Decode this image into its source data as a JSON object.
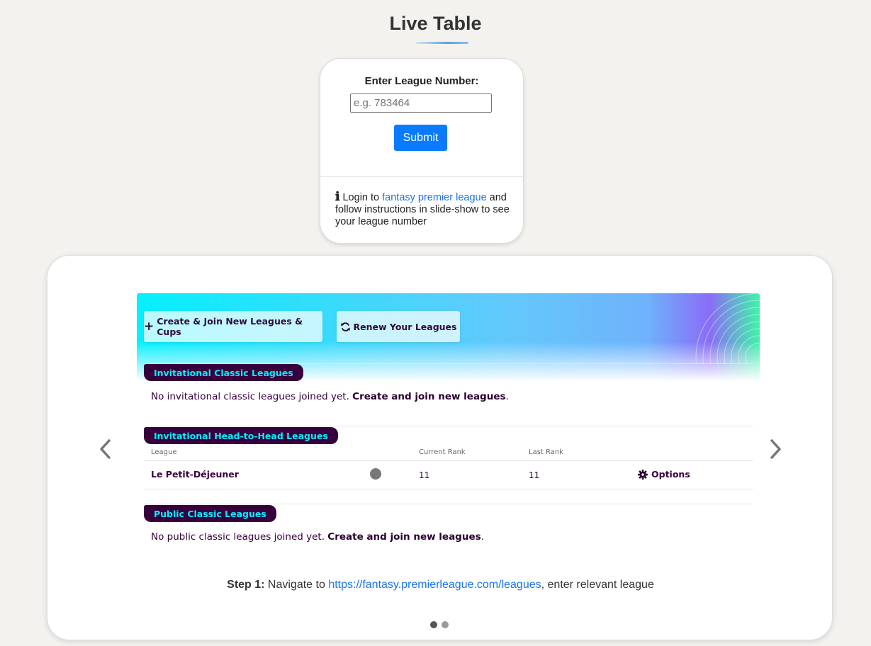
{
  "page": {
    "title": "Live Table"
  },
  "form": {
    "label": "Enter League Number:",
    "input_value": "",
    "input_placeholder": "e.g. 783464",
    "submit_label": "Submit",
    "info_icon": "ℹ",
    "info_prefix": " Login to ",
    "info_link": "fantasy premier league",
    "info_suffix": " and follow instructions in slide-show to see your league number"
  },
  "slideshow": {
    "prev_icon": "chevron-left-icon",
    "next_icon": "chevron-right-icon",
    "image": {
      "buttons": {
        "create": "Create & Join New Leagues & Cups",
        "renew": "Renew Your Leagues"
      },
      "sections": {
        "invitational_classic": {
          "title": "Invitational Classic Leagues",
          "text": "No invitational classic leagues joined yet. ",
          "cta": "Create and join new leagues",
          "end": "."
        },
        "invitational_h2h": {
          "title": "Invitational Head-to-Head Leagues",
          "columns": [
            "League",
            "Current Rank",
            "Last Rank"
          ],
          "rows": [
            {
              "league": "Le Petit-Déjeuner",
              "current_rank": "11",
              "last_rank": "11",
              "options": "Options"
            }
          ]
        },
        "public_classic": {
          "title": "Public Classic Leagues",
          "text": "No public classic leagues joined yet. ",
          "cta": "Create and join new leagues",
          "end": "."
        }
      }
    },
    "caption": {
      "step": "Step 1:",
      "prefix": " Navigate to ",
      "link": "https://fantasy.premierleague.com/leagues",
      "suffix": ", enter relevant league"
    },
    "total_slides": 2,
    "active_slide": 1
  },
  "colors": {
    "accent": "#0a7bff",
    "link": "#1a73e8",
    "fpl_purple": "#37003c",
    "fpl_cyan": "#05f0ff"
  }
}
